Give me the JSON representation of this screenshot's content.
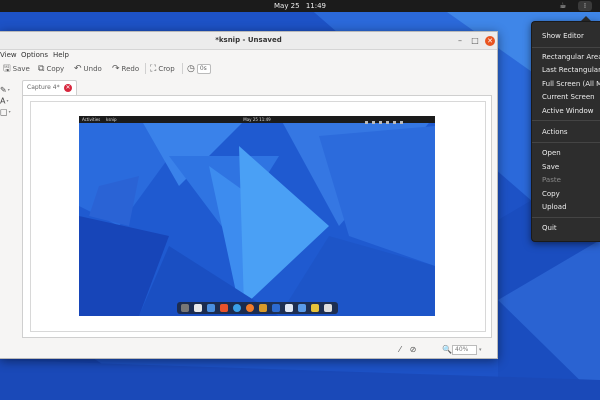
{
  "topbar": {
    "date": "May 25",
    "time": "11:49",
    "tray_cup_icon": "coffee-cup-icon",
    "tray_app_icon": "ksnip-tray-icon"
  },
  "window": {
    "title": "*ksnip - Unsaved",
    "menu": [
      "View",
      "Options",
      "Help"
    ],
    "toolbar": {
      "save": "Save",
      "copy": "Copy",
      "undo": "Undo",
      "redo": "Redo",
      "crop": "Crop",
      "delay_value": "0s"
    },
    "tab_label": "Capture 4*",
    "zoom_value": "40%"
  },
  "capture": {
    "app_name": "ksnip",
    "activities": "Activities",
    "clock": "May 25 11:49"
  },
  "tray_menu": {
    "items": [
      {
        "label": "Show Editor",
        "enabled": true
      },
      {
        "label": "Rectangular Area",
        "enabled": true
      },
      {
        "label": "Last Rectangular Area",
        "enabled": true
      },
      {
        "label": "Full Screen (All Monitors)",
        "enabled": true
      },
      {
        "label": "Current Screen",
        "enabled": true
      },
      {
        "label": "Active Window",
        "enabled": true
      },
      {
        "label": "Actions",
        "enabled": true
      },
      {
        "label": "Open",
        "enabled": true
      },
      {
        "label": "Save",
        "enabled": true
      },
      {
        "label": "Paste",
        "enabled": false
      },
      {
        "label": "Copy",
        "enabled": true
      },
      {
        "label": "Upload",
        "enabled": true
      },
      {
        "label": "Quit",
        "enabled": true
      }
    ]
  },
  "colors": {
    "wallpaper_dark": "#0f3fa8",
    "wallpaper_light": "#3f86e8",
    "accent": "#e95420",
    "tab_close": "#d7263d"
  }
}
